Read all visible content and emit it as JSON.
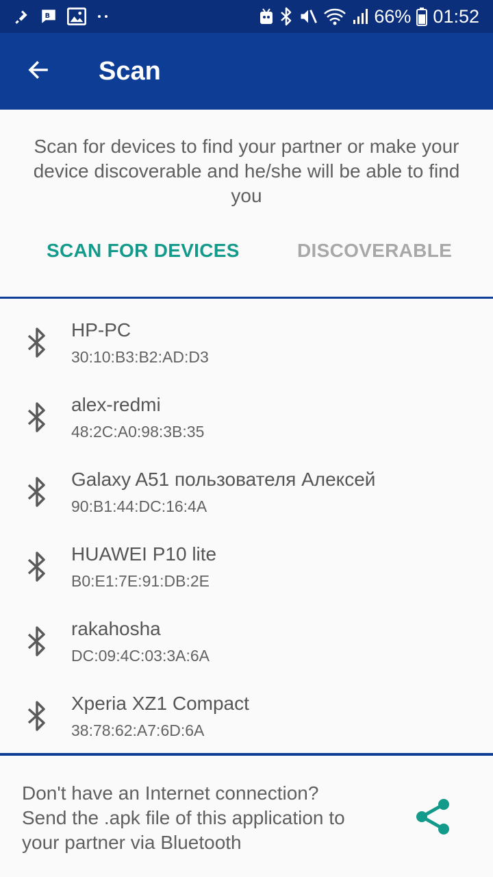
{
  "status_bar": {
    "battery": "66%",
    "time": "01:52",
    "icons": [
      "usb-debug-icon",
      "bbm-icon",
      "image-icon",
      "dots-icon",
      "android-icon",
      "bluetooth-icon",
      "mute-icon",
      "wifi-icon",
      "signal-icon",
      "battery-icon"
    ]
  },
  "app_bar": {
    "title": "Scan",
    "back_icon": "arrow-back-icon",
    "color": "#0e3d96"
  },
  "intro": {
    "text": "Scan for devices to find your partner or make your device discoverable and he/she will be able to find you"
  },
  "tabs": {
    "scan": "SCAN FOR DEVICES",
    "discoverable": "DISCOVERABLE",
    "active_color": "#139a8b",
    "inactive_color": "#a8a8a8"
  },
  "devices": [
    {
      "name": "HP-PC",
      "address": "30:10:B3:B2:AD:D3"
    },
    {
      "name": "alex-redmi",
      "address": "48:2C:A0:98:3B:35"
    },
    {
      "name": "Galaxy A51 пользователя Алексей",
      "address": "90:B1:44:DC:16:4A"
    },
    {
      "name": "HUAWEI P10 lite",
      "address": "B0:E1:7E:91:DB:2E"
    },
    {
      "name": "rakahosha",
      "address": "DC:09:4C:03:3A:6A"
    },
    {
      "name": "Xperia XZ1 Compact",
      "address": "38:78:62:A7:6D:6A"
    }
  ],
  "footer": {
    "line1": "Don't have an Internet connection?",
    "line2": "Send the .apk file of this application to",
    "line3": "your partner via Bluetooth",
    "share_icon": "share-icon"
  }
}
